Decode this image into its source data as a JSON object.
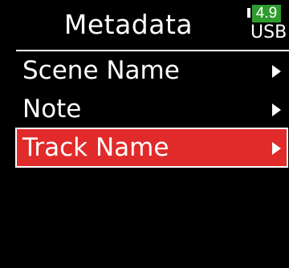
{
  "header": {
    "title": "Metadata",
    "battery": {
      "value": "4.9",
      "source": "USB"
    }
  },
  "menu": {
    "items": [
      {
        "label": "Scene Name",
        "selected": false
      },
      {
        "label": "Note",
        "selected": false
      },
      {
        "label": "Track Name",
        "selected": true
      }
    ]
  },
  "colors": {
    "selected_bg": "#e12b2b",
    "battery_bg": "#2e9b2e",
    "text": "#ffffff",
    "background": "#000000"
  }
}
